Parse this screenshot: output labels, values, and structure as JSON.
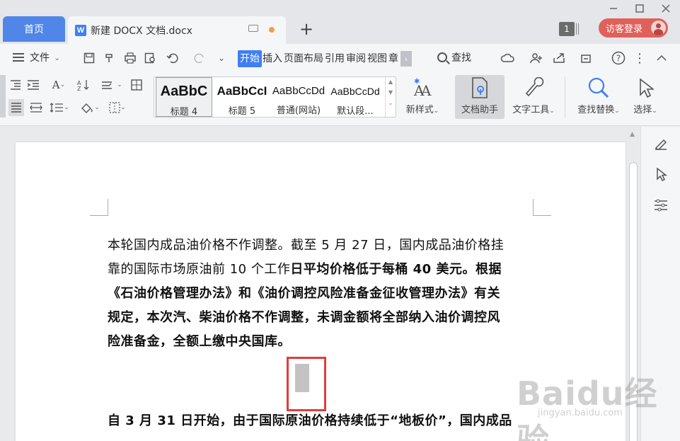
{
  "titlebar": {
    "home_tab": "首页",
    "doc_tab": "新建 DOCX 文档.docx",
    "doc_icon_letter": "W",
    "new_tab": "+",
    "window_count": "1",
    "guest_login": "访客登录"
  },
  "menubar": {
    "file_label": "文件",
    "tabs": [
      "开始",
      "插入",
      "页面布局",
      "引用",
      "审阅",
      "视图",
      "章"
    ],
    "active_tab": "开始",
    "search_label": "查找"
  },
  "ribbon": {
    "styles": [
      {
        "sample": "AaBbC",
        "name": "标题 4"
      },
      {
        "sample": "AaBbCcI",
        "name": "标题 5"
      },
      {
        "sample": "AaBbCcDd",
        "name": "普通(网站)"
      },
      {
        "sample": "AaBbCcDd",
        "name": "默认段..."
      }
    ],
    "new_style": "新样式",
    "doc_helper": "文档助手",
    "text_tools": "文字工具",
    "find_replace": "查找替换",
    "select": "选择"
  },
  "document": {
    "para1": {
      "line1": "本轮国内成品油价格不作调整。截至 5 月 27 日，国内成品油价格挂",
      "line2_normal": "靠的国际市场原油前 10 个工作",
      "line2_bold": "日平均价格低于每桶 40 美元。根据",
      "line3": "《石油价格管理办法》和《油价调控风险准备金征收管理办法》有关",
      "line4": "规定，本次汽、柴油价格不作调整，未调金额将全部纳入油价调控风",
      "line5": "险准备金，全额上缴中央国库。"
    },
    "para2": {
      "line1": "自 3 月 31 日开始，由于国际原油价格持续低于“地板价”，国内成品"
    }
  },
  "watermark": {
    "big": "Baidu经验",
    "small": "jingyan.baidu.com"
  }
}
